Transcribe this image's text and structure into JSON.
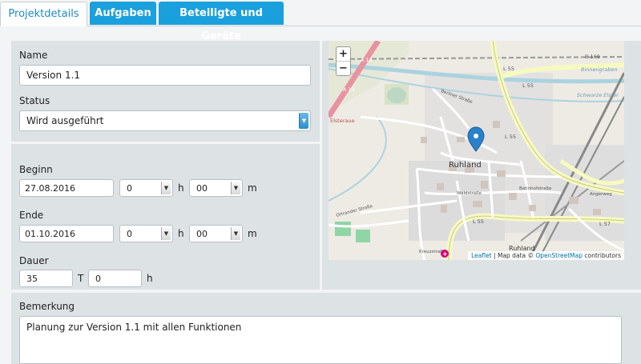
{
  "tabs": [
    {
      "label": "Projektdetails",
      "active": true
    },
    {
      "label": "Aufgaben",
      "active": false
    },
    {
      "label": "Beteiligte und Geräte",
      "active": false
    }
  ],
  "form": {
    "name_label": "Name",
    "name_value": "Version 1.1",
    "status_label": "Status",
    "status_value": "Wird ausgeführt",
    "begin_label": "Beginn",
    "begin_date": "27.08.2016",
    "begin_hours": "0",
    "begin_minutes": "00",
    "end_label": "Ende",
    "end_date": "01.10.2016",
    "end_hours": "0",
    "end_minutes": "00",
    "hour_unit": "h",
    "minute_unit": "m",
    "duration_label": "Dauer",
    "duration_days": "35",
    "day_unit": "T",
    "duration_hours": "0",
    "remark_label": "Bemerkung",
    "remark_value": "Planung zur Version 1.1 mit allen Funktionen"
  },
  "map": {
    "zoom_in": "+",
    "zoom_out": "−",
    "labels": {
      "a13_top": "A 13",
      "a13_bottom": "A 13",
      "b169": "B 169",
      "l55_top": "L 55",
      "l55_mid": "L 55",
      "l55_right": "L 55",
      "l55_bottom": "L 55",
      "l57": "L 57",
      "town_center": "Ruhland",
      "town_station": "Ruhland",
      "binnengraben": "Binnengraben",
      "schwarze_elster": "Schwarze Elster",
      "elsteraue": "Elsteraue",
      "berliner_strasse": "Berliner Straße",
      "bahnhofstrasse": "Bahnhofstraße",
      "waldstrasse": "Waldstraße",
      "angerweg": "Angerweg",
      "kreuzstrasse": "Kreuzstraße",
      "ortrander_strasse": "Ortrander Straße"
    },
    "attribution_leaflet": "Leaflet",
    "attribution_text": " | Map data © ",
    "attribution_osm": "OpenStreetMap",
    "attribution_tail": " contributors"
  },
  "colors": {
    "accent": "#1aa0dd",
    "marker": "#2a81cb",
    "motorway": "#e892a2",
    "primary_road": "#fcd6a4",
    "secondary_road": "#f7fabf"
  }
}
